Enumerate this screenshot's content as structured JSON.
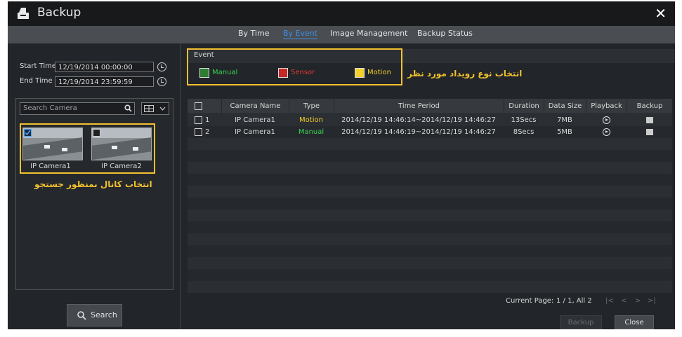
{
  "window": {
    "title": "Backup",
    "close_glyph": "✕"
  },
  "tabs": [
    {
      "label": "By Time",
      "active": false
    },
    {
      "label": "By Event",
      "active": true
    },
    {
      "label": "Image Management",
      "active": false
    },
    {
      "label": "Backup Status",
      "active": false
    }
  ],
  "left": {
    "start_label": "Start Time",
    "start_value": "12/19/2014 00:00:00",
    "end_label": "End Time",
    "end_value": "12/19/2014 23:59:59",
    "search_placeholder": "Search Camera",
    "cameras": [
      {
        "name": "IP Camera1",
        "checked": true
      },
      {
        "name": "IP Camera2",
        "checked": false
      }
    ],
    "annotation": "انتخاب کانال بمنظور جستجو",
    "search_button": "Search"
  },
  "event": {
    "label": "Event",
    "types": [
      {
        "label": "Manual",
        "color": "#39d353"
      },
      {
        "label": "Sensor",
        "color": "#e53935"
      },
      {
        "label": "Motion",
        "color": "#f2d02e"
      }
    ],
    "annotation": "انتخاب نوع رویداد مورد نظر"
  },
  "table": {
    "columns": [
      "Camera Name",
      "Type",
      "Time Period",
      "Duration",
      "Data Size",
      "Playback",
      "Backup"
    ],
    "rows": [
      {
        "index": "1",
        "camera": "IP Camera1",
        "type": "Motion",
        "type_color": "#f2d02e",
        "period": "2014/12/19 14:46:14~2014/12/19 14:46:27",
        "duration": "13Secs",
        "size": "7MB"
      },
      {
        "index": "2",
        "camera": "IP Camera1",
        "type": "Manual",
        "type_color": "#39d353",
        "period": "2014/12/19 14:46:19~2014/12/19 14:46:27",
        "duration": "8Secs",
        "size": "5MB"
      }
    ]
  },
  "pager": {
    "label": "Current Page:",
    "value": "1 / 1, All 2",
    "nav": [
      "|<",
      "<",
      ">",
      ">|"
    ]
  },
  "buttons": {
    "backup": "Backup",
    "close": "Close"
  }
}
